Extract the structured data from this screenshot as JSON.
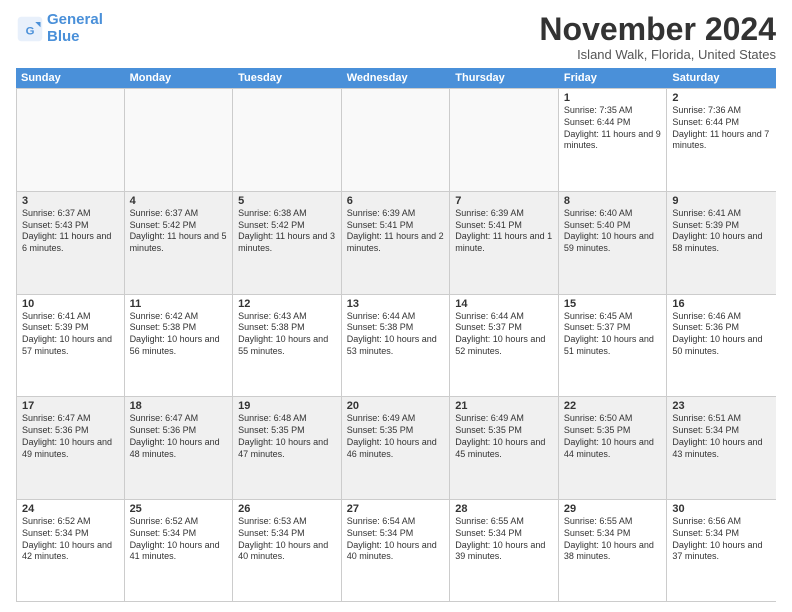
{
  "logo": {
    "line1": "General",
    "line2": "Blue"
  },
  "title": "November 2024",
  "location": "Island Walk, Florida, United States",
  "weekdays": [
    "Sunday",
    "Monday",
    "Tuesday",
    "Wednesday",
    "Thursday",
    "Friday",
    "Saturday"
  ],
  "weeks": [
    [
      {
        "day": "",
        "info": ""
      },
      {
        "day": "",
        "info": ""
      },
      {
        "day": "",
        "info": ""
      },
      {
        "day": "",
        "info": ""
      },
      {
        "day": "",
        "info": ""
      },
      {
        "day": "1",
        "info": "Sunrise: 7:35 AM\nSunset: 6:44 PM\nDaylight: 11 hours and 9 minutes."
      },
      {
        "day": "2",
        "info": "Sunrise: 7:36 AM\nSunset: 6:44 PM\nDaylight: 11 hours and 7 minutes."
      }
    ],
    [
      {
        "day": "3",
        "info": "Sunrise: 6:37 AM\nSunset: 5:43 PM\nDaylight: 11 hours and 6 minutes."
      },
      {
        "day": "4",
        "info": "Sunrise: 6:37 AM\nSunset: 5:42 PM\nDaylight: 11 hours and 5 minutes."
      },
      {
        "day": "5",
        "info": "Sunrise: 6:38 AM\nSunset: 5:42 PM\nDaylight: 11 hours and 3 minutes."
      },
      {
        "day": "6",
        "info": "Sunrise: 6:39 AM\nSunset: 5:41 PM\nDaylight: 11 hours and 2 minutes."
      },
      {
        "day": "7",
        "info": "Sunrise: 6:39 AM\nSunset: 5:41 PM\nDaylight: 11 hours and 1 minute."
      },
      {
        "day": "8",
        "info": "Sunrise: 6:40 AM\nSunset: 5:40 PM\nDaylight: 10 hours and 59 minutes."
      },
      {
        "day": "9",
        "info": "Sunrise: 6:41 AM\nSunset: 5:39 PM\nDaylight: 10 hours and 58 minutes."
      }
    ],
    [
      {
        "day": "10",
        "info": "Sunrise: 6:41 AM\nSunset: 5:39 PM\nDaylight: 10 hours and 57 minutes."
      },
      {
        "day": "11",
        "info": "Sunrise: 6:42 AM\nSunset: 5:38 PM\nDaylight: 10 hours and 56 minutes."
      },
      {
        "day": "12",
        "info": "Sunrise: 6:43 AM\nSunset: 5:38 PM\nDaylight: 10 hours and 55 minutes."
      },
      {
        "day": "13",
        "info": "Sunrise: 6:44 AM\nSunset: 5:38 PM\nDaylight: 10 hours and 53 minutes."
      },
      {
        "day": "14",
        "info": "Sunrise: 6:44 AM\nSunset: 5:37 PM\nDaylight: 10 hours and 52 minutes."
      },
      {
        "day": "15",
        "info": "Sunrise: 6:45 AM\nSunset: 5:37 PM\nDaylight: 10 hours and 51 minutes."
      },
      {
        "day": "16",
        "info": "Sunrise: 6:46 AM\nSunset: 5:36 PM\nDaylight: 10 hours and 50 minutes."
      }
    ],
    [
      {
        "day": "17",
        "info": "Sunrise: 6:47 AM\nSunset: 5:36 PM\nDaylight: 10 hours and 49 minutes."
      },
      {
        "day": "18",
        "info": "Sunrise: 6:47 AM\nSunset: 5:36 PM\nDaylight: 10 hours and 48 minutes."
      },
      {
        "day": "19",
        "info": "Sunrise: 6:48 AM\nSunset: 5:35 PM\nDaylight: 10 hours and 47 minutes."
      },
      {
        "day": "20",
        "info": "Sunrise: 6:49 AM\nSunset: 5:35 PM\nDaylight: 10 hours and 46 minutes."
      },
      {
        "day": "21",
        "info": "Sunrise: 6:49 AM\nSunset: 5:35 PM\nDaylight: 10 hours and 45 minutes."
      },
      {
        "day": "22",
        "info": "Sunrise: 6:50 AM\nSunset: 5:35 PM\nDaylight: 10 hours and 44 minutes."
      },
      {
        "day": "23",
        "info": "Sunrise: 6:51 AM\nSunset: 5:34 PM\nDaylight: 10 hours and 43 minutes."
      }
    ],
    [
      {
        "day": "24",
        "info": "Sunrise: 6:52 AM\nSunset: 5:34 PM\nDaylight: 10 hours and 42 minutes."
      },
      {
        "day": "25",
        "info": "Sunrise: 6:52 AM\nSunset: 5:34 PM\nDaylight: 10 hours and 41 minutes."
      },
      {
        "day": "26",
        "info": "Sunrise: 6:53 AM\nSunset: 5:34 PM\nDaylight: 10 hours and 40 minutes."
      },
      {
        "day": "27",
        "info": "Sunrise: 6:54 AM\nSunset: 5:34 PM\nDaylight: 10 hours and 40 minutes."
      },
      {
        "day": "28",
        "info": "Sunrise: 6:55 AM\nSunset: 5:34 PM\nDaylight: 10 hours and 39 minutes."
      },
      {
        "day": "29",
        "info": "Sunrise: 6:55 AM\nSunset: 5:34 PM\nDaylight: 10 hours and 38 minutes."
      },
      {
        "day": "30",
        "info": "Sunrise: 6:56 AM\nSunset: 5:34 PM\nDaylight: 10 hours and 37 minutes."
      }
    ]
  ]
}
